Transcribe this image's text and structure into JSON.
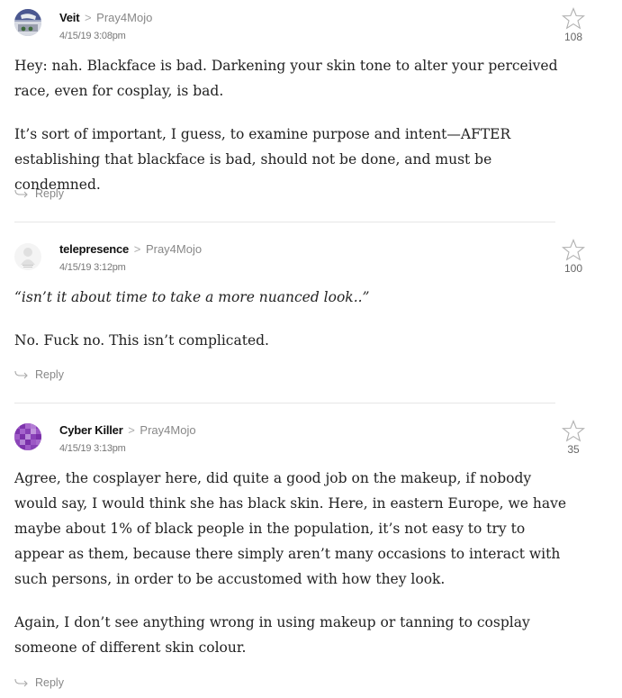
{
  "comments": [
    {
      "author": "Veit",
      "reply_to": "Pray4Mojo",
      "timestamp": "4/15/19 3:08pm",
      "stars": "108",
      "avatar_icon": "avatar-veit-image",
      "paragraphs": [
        "Hey: nah. Blackface is bad. Darkening your skin tone to alter your perceived race, even for cosplay, is bad.",
        "It’s sort of important, I guess, to examine purpose and intent—AFTER establishing that blackface is bad, should not be done, and must be condemned."
      ],
      "reply_label": "Reply"
    },
    {
      "author": "telepresence",
      "reply_to": "Pray4Mojo",
      "timestamp": "4/15/19 3:12pm",
      "stars": "100",
      "avatar_icon": "avatar-no-image-placeholder",
      "quote": "“isn’t it about time to take a more nuanced look..”",
      "paragraphs": [
        "No.  Fuck no.  This isn’t complicated."
      ],
      "reply_label": "Reply"
    },
    {
      "author": "Cyber Killer",
      "reply_to": "Pray4Mojo",
      "timestamp": "4/15/19 3:13pm",
      "stars": "35",
      "avatar_icon": "avatar-purple-pixel",
      "paragraphs": [
        "Agree, the cosplayer here, did quite a good job on the makeup, if nobody would say, I would think she has black skin. Here, in eastern Europe, we have maybe about 1% of black people in the population, it’s not easy to try to appear as them, because there simply aren’t many occasions to interact with such persons, in order to be accustomed with how they look.",
        "Again, I don’t see anything wrong in using makeup or tanning to cosplay someone of different skin colour."
      ],
      "reply_label": "Reply"
    }
  ],
  "separator_glyph": ">",
  "colors": {
    "author": "#111111",
    "meta": "#888888",
    "body": "#222222",
    "divider": "#e6e6e6",
    "star_outline": "#b0b0b0"
  }
}
